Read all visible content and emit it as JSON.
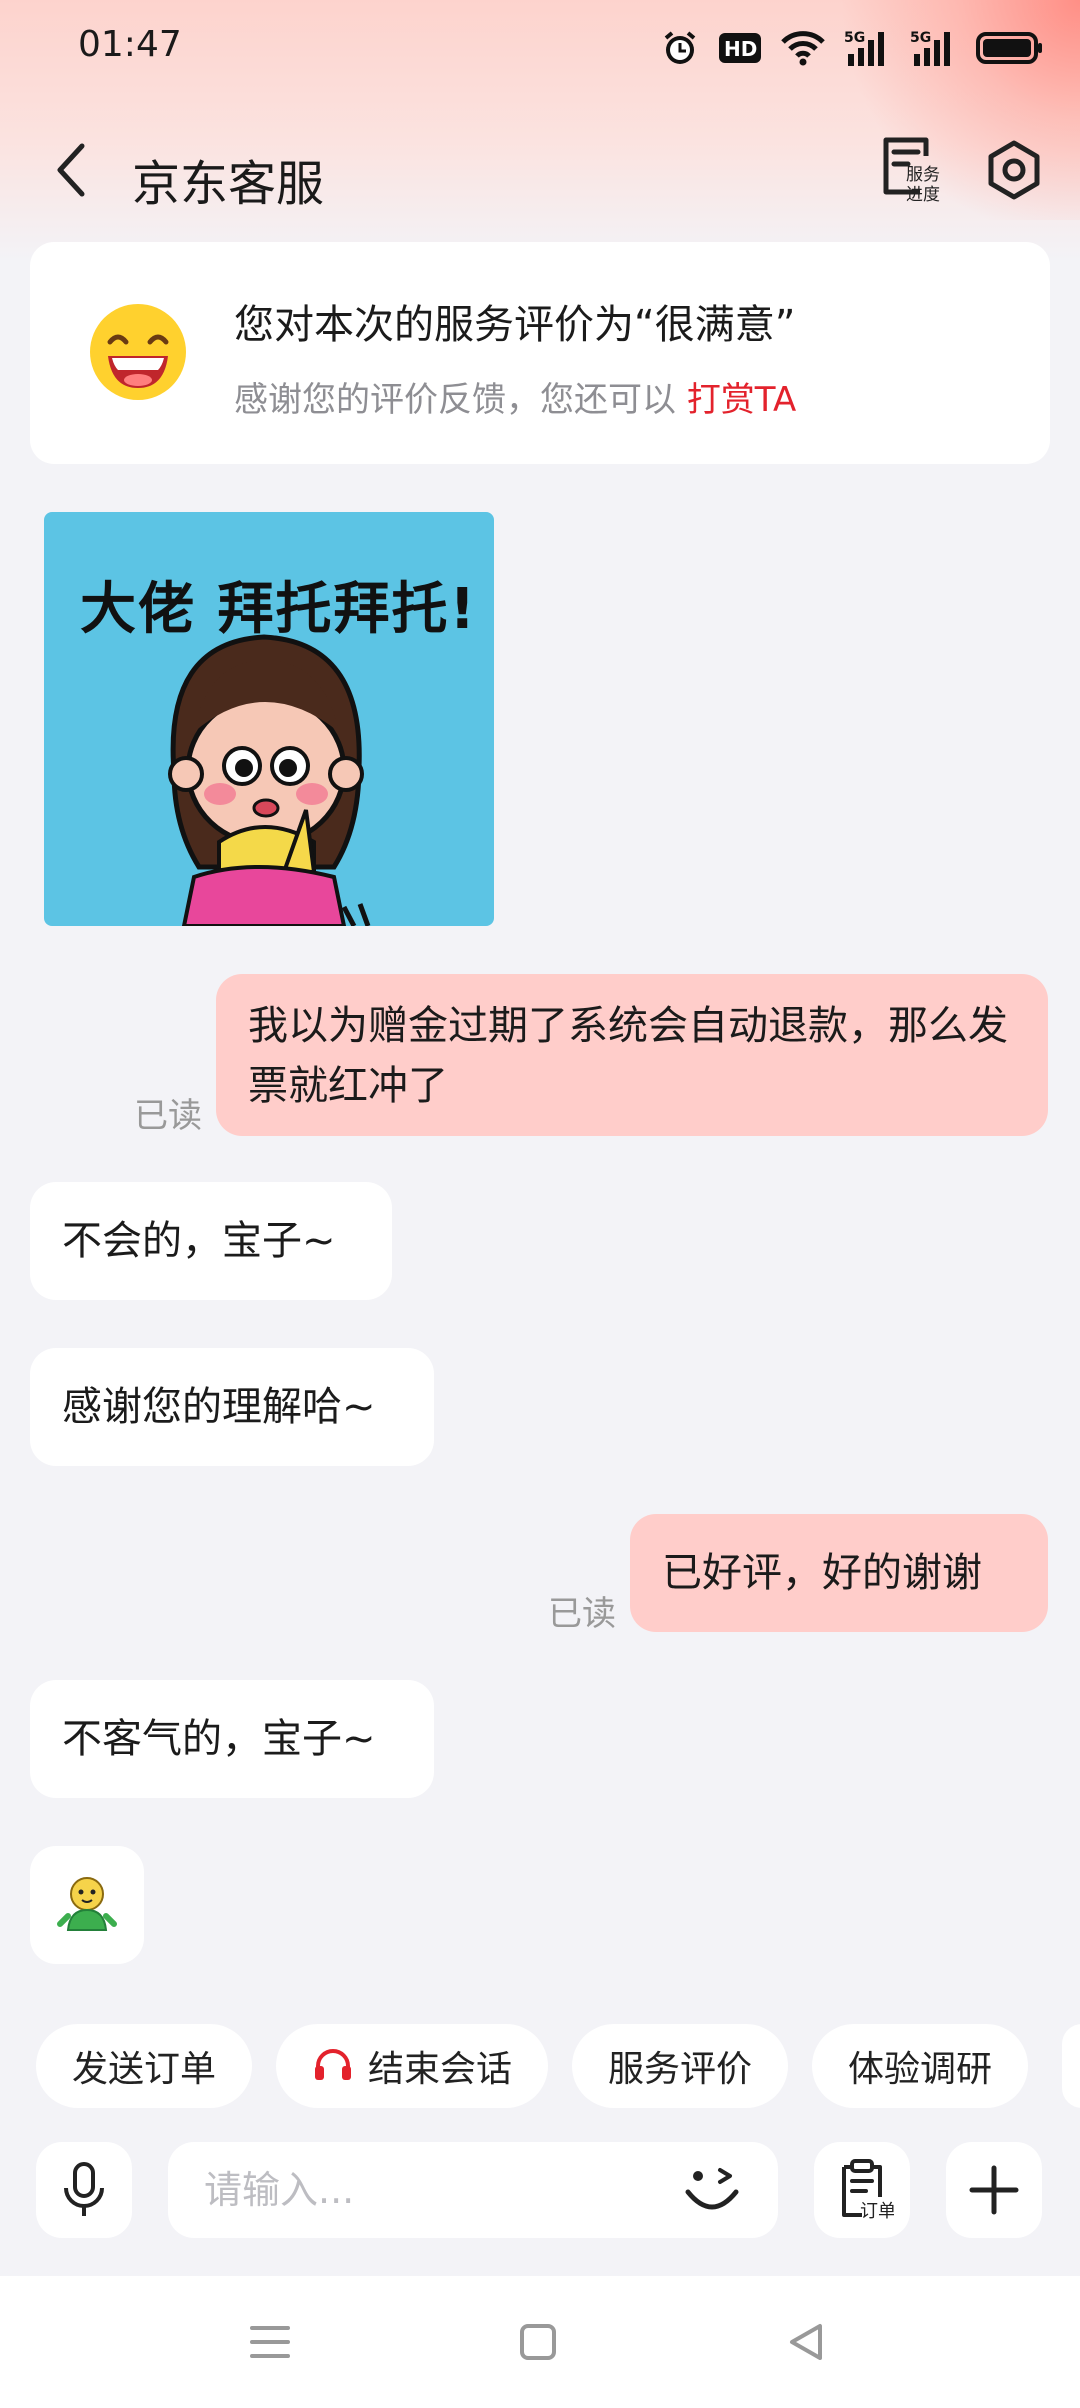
{
  "status_bar": {
    "time": "01:47",
    "icons": [
      "alarm-icon",
      "hd-icon",
      "wifi-icon",
      "5g-signal-icon",
      "5g-signal-icon",
      "battery-icon"
    ],
    "hd_text": "HD",
    "network_1": "5G",
    "network_2": "5G"
  },
  "header": {
    "title": "京东客服",
    "progress_label_line1": "服务",
    "progress_label_line2": "进度"
  },
  "rating": {
    "title": "您对本次的服务评价为“很满意”",
    "subtitle": "感谢您的评价反馈，您还可以 ",
    "tip_link": "打赏TA"
  },
  "sticker": {
    "text": "大佬 拜托拜托!"
  },
  "messages": [
    {
      "from": "me",
      "text": "我以为赠金过期了系统会自动退款，那么发票就红冲了",
      "status": "已读"
    },
    {
      "from": "agent",
      "text": "不会的，宝子~"
    },
    {
      "from": "agent",
      "text": "感谢您的理解哈~"
    },
    {
      "from": "me",
      "text": "已好评，好的谢谢",
      "status": "已读"
    },
    {
      "from": "agent",
      "text": "不客气的，宝子~"
    }
  ],
  "quick_actions": [
    "发送订单",
    "结束会话",
    "服务评价",
    "体验调研"
  ],
  "input": {
    "placeholder": "请输入...",
    "order_label": "订单"
  },
  "colors": {
    "accent_red": "#e3222c",
    "outgoing_bubble": "#ffcdca",
    "background": "#f3f3f7",
    "sticker_bg": "#5cc4e4"
  }
}
